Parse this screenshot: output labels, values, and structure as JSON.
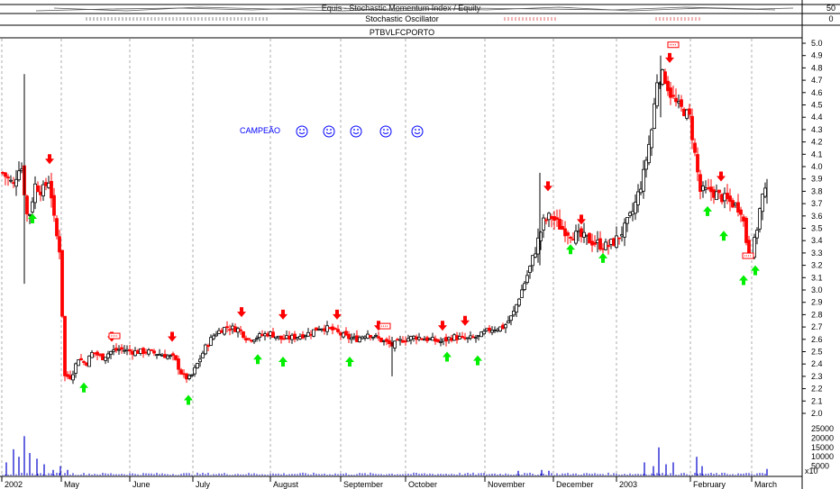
{
  "header": {
    "indicator_text": "Equis - Stochastic Momentum Index / Equity",
    "stoch_label": "Stochastic Oscillator",
    "symbol": "PTBVLFCPORTO",
    "right_scale_top": "50",
    "right_scale_bottom": "0"
  },
  "annotation": {
    "text": "CAMPEÃO",
    "smiley_count": 5
  },
  "colors": {
    "up_candle": "#000000",
    "down_candle": "#ff0000",
    "buy_arrow": "#00ee00",
    "sell_arrow": "#ff0000",
    "volume": "#0000cc",
    "annotation": "#0000ff",
    "grid": "#9a9a9a"
  },
  "volume_axis": {
    "ticks": [
      "25000",
      "20000",
      "15000",
      "10000",
      "5000",
      "x10"
    ]
  },
  "chart_data": {
    "type": "candlestick",
    "title": "PTBVLFCPORTO",
    "y_ticks": [
      "5.0",
      "4.9",
      "4.8",
      "4.7",
      "4.6",
      "4.5",
      "4.4",
      "4.3",
      "4.2",
      "4.1",
      "4.0",
      "3.9",
      "3.8",
      "3.7",
      "3.6",
      "3.5",
      "3.4",
      "3.3",
      "3.2",
      "3.1",
      "3.0",
      "2.9",
      "2.8",
      "2.7",
      "2.6",
      "2.5",
      "2.4",
      "2.3",
      "2.2",
      "2.1",
      "2.0"
    ],
    "ylim": [
      2.0,
      5.0
    ],
    "x_labels": [
      {
        "label": "2002",
        "day": 0
      },
      {
        "label": "May",
        "day": 66
      },
      {
        "label": "June",
        "day": 142
      },
      {
        "label": "July",
        "day": 212
      },
      {
        "label": "August",
        "day": 298
      },
      {
        "label": "September",
        "day": 376
      },
      {
        "label": "October",
        "day": 448
      },
      {
        "label": "November",
        "day": 536
      },
      {
        "label": "December",
        "day": 612
      },
      {
        "label": "2003",
        "day": 682
      },
      {
        "label": "February",
        "day": 764
      },
      {
        "label": "March",
        "day": 832
      }
    ],
    "month_gridlines": [
      0,
      66,
      142,
      212,
      298,
      376,
      448,
      536,
      612,
      682,
      764,
      832
    ],
    "price_path": [
      [
        0,
        3.95
      ],
      [
        12,
        3.85
      ],
      [
        20,
        4.05
      ],
      [
        28,
        3.55
      ],
      [
        36,
        3.85
      ],
      [
        44,
        3.8
      ],
      [
        52,
        3.9
      ],
      [
        58,
        3.5
      ],
      [
        64,
        3.3
      ],
      [
        68,
        2.3
      ],
      [
        76,
        2.3
      ],
      [
        84,
        2.45
      ],
      [
        92,
        2.4
      ],
      [
        100,
        2.5
      ],
      [
        110,
        2.45
      ],
      [
        120,
        2.5
      ],
      [
        130,
        2.52
      ],
      [
        145,
        2.5
      ],
      [
        160,
        2.5
      ],
      [
        175,
        2.48
      ],
      [
        190,
        2.45
      ],
      [
        200,
        2.3
      ],
      [
        208,
        2.28
      ],
      [
        216,
        2.4
      ],
      [
        226,
        2.55
      ],
      [
        236,
        2.65
      ],
      [
        248,
        2.7
      ],
      [
        262,
        2.68
      ],
      [
        272,
        2.6
      ],
      [
        282,
        2.62
      ],
      [
        296,
        2.65
      ],
      [
        310,
        2.6
      ],
      [
        325,
        2.62
      ],
      [
        340,
        2.65
      ],
      [
        352,
        2.7
      ],
      [
        365,
        2.68
      ],
      [
        380,
        2.62
      ],
      [
        392,
        2.6
      ],
      [
        405,
        2.65
      ],
      [
        418,
        2.6
      ],
      [
        432,
        2.55
      ],
      [
        445,
        2.6
      ],
      [
        458,
        2.62
      ],
      [
        472,
        2.6
      ],
      [
        486,
        2.58
      ],
      [
        500,
        2.62
      ],
      [
        514,
        2.6
      ],
      [
        528,
        2.62
      ],
      [
        540,
        2.68
      ],
      [
        556,
        2.7
      ],
      [
        566,
        2.8
      ],
      [
        576,
        3.0
      ],
      [
        586,
        3.2
      ],
      [
        594,
        3.4
      ],
      [
        600,
        3.55
      ],
      [
        608,
        3.6
      ],
      [
        620,
        3.5
      ],
      [
        632,
        3.45
      ],
      [
        646,
        3.42
      ],
      [
        658,
        3.38
      ],
      [
        670,
        3.35
      ],
      [
        680,
        3.4
      ],
      [
        690,
        3.5
      ],
      [
        700,
        3.65
      ],
      [
        710,
        3.9
      ],
      [
        720,
        4.3
      ],
      [
        726,
        4.7
      ],
      [
        733,
        4.75
      ],
      [
        740,
        4.6
      ],
      [
        748,
        4.5
      ],
      [
        756,
        4.45
      ],
      [
        762,
        4.4
      ],
      [
        768,
        4.1
      ],
      [
        774,
        3.8
      ],
      [
        786,
        3.8
      ],
      [
        798,
        3.75
      ],
      [
        810,
        3.7
      ],
      [
        820,
        3.65
      ],
      [
        826,
        3.35
      ],
      [
        832,
        3.3
      ],
      [
        838,
        3.55
      ],
      [
        842,
        3.75
      ],
      [
        848,
        3.8
      ]
    ],
    "buy_signals": [
      {
        "day": 34,
        "price": 3.62
      },
      {
        "day": 91,
        "price": 2.25
      },
      {
        "day": 207,
        "price": 2.15
      },
      {
        "day": 284,
        "price": 2.48
      },
      {
        "day": 312,
        "price": 2.46
      },
      {
        "day": 386,
        "price": 2.46
      },
      {
        "day": 494,
        "price": 2.5
      },
      {
        "day": 528,
        "price": 2.47
      },
      {
        "day": 631,
        "price": 3.37
      },
      {
        "day": 667,
        "price": 3.3
      },
      {
        "day": 783,
        "price": 3.68
      },
      {
        "day": 801,
        "price": 3.48
      },
      {
        "day": 823,
        "price": 3.12
      },
      {
        "day": 836,
        "price": 3.2
      }
    ],
    "sell_signals": [
      {
        "day": 53,
        "price": 4.02
      },
      {
        "day": 122,
        "price": 2.58
      },
      {
        "day": 189,
        "price": 2.58
      },
      {
        "day": 266,
        "price": 2.78
      },
      {
        "day": 312,
        "price": 2.76
      },
      {
        "day": 372,
        "price": 2.76
      },
      {
        "day": 418,
        "price": 2.67
      },
      {
        "day": 489,
        "price": 2.67
      },
      {
        "day": 514,
        "price": 2.71
      },
      {
        "day": 606,
        "price": 3.8
      },
      {
        "day": 643,
        "price": 3.53
      },
      {
        "day": 741,
        "price": 4.84
      },
      {
        "day": 798,
        "price": 3.88
      }
    ],
    "exit_markers": [
      {
        "day": 125,
        "price": 2.62
      },
      {
        "day": 425,
        "price": 2.7
      },
      {
        "day": 745,
        "price": 4.98
      },
      {
        "day": 828,
        "price": 3.27
      }
    ],
    "volume_spikes": [
      {
        "day": 4,
        "value": 7000
      },
      {
        "day": 12,
        "value": 14000
      },
      {
        "day": 18,
        "value": 10000
      },
      {
        "day": 24,
        "value": 21000
      },
      {
        "day": 30,
        "value": 12000
      },
      {
        "day": 38,
        "value": 9000
      },
      {
        "day": 46,
        "value": 6000
      },
      {
        "day": 56,
        "value": 3000
      },
      {
        "day": 64,
        "value": 5000
      },
      {
        "day": 72,
        "value": 3000
      },
      {
        "day": 572,
        "value": 2500
      },
      {
        "day": 598,
        "value": 3000
      },
      {
        "day": 606,
        "value": 2500
      },
      {
        "day": 712,
        "value": 7000
      },
      {
        "day": 722,
        "value": 5000
      },
      {
        "day": 728,
        "value": 15000
      },
      {
        "day": 736,
        "value": 6000
      },
      {
        "day": 744,
        "value": 7000
      },
      {
        "day": 770,
        "value": 10000
      },
      {
        "day": 776,
        "value": 5000
      },
      {
        "day": 848,
        "value": 3500
      }
    ]
  }
}
